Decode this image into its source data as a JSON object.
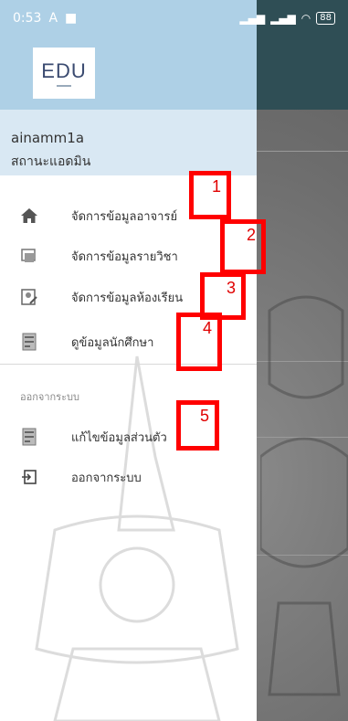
{
  "status_bar": {
    "time": "0:53",
    "a_indicator": "A",
    "battery_level": "88"
  },
  "drawer": {
    "logo_text": "EDU",
    "username": "ainamm1a",
    "role": "สถานะแอดมิน",
    "menu": [
      {
        "label": "จัดการข้อมูลอาจารย์",
        "icon": "home-icon"
      },
      {
        "label": "จัดการข้อมูลรายวิชา",
        "icon": "subject-icon"
      },
      {
        "label": "จัดการข้อมูลห้องเรียน",
        "icon": "classroom-icon"
      },
      {
        "label": "ดูข้อมูลนักศึกษา",
        "icon": "student-icon"
      }
    ],
    "section_label": "ออกจากระบบ",
    "account_menu": [
      {
        "label": "แก้ไขข้อมูลส่วนตัว",
        "icon": "profile-edit-icon"
      },
      {
        "label": "ออกจากระบบ",
        "icon": "logout-icon"
      }
    ]
  },
  "annotations": [
    "1",
    "2",
    "3",
    "4",
    "5"
  ],
  "colors": {
    "header": "#aed0e6",
    "user_section": "#d9e8f3",
    "annotation": "#ff0000",
    "app_bar": "#2f4e55"
  }
}
